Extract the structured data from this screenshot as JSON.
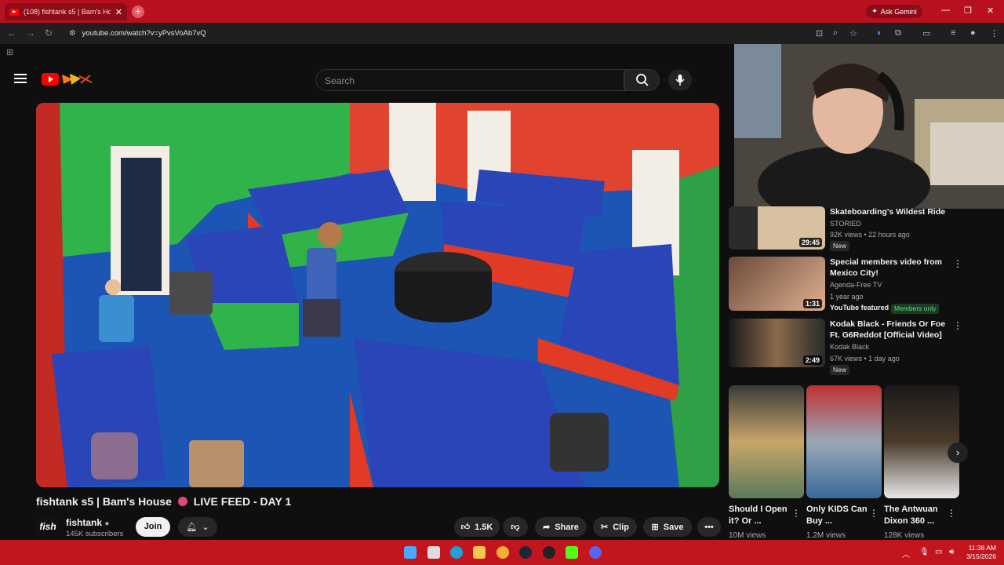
{
  "browser": {
    "tab_title": "(108) fishtank s5 | Bam's Ho",
    "url": "youtube.com/watch?v=yPvsVoAb7vQ",
    "gemini_label": "Ask Gemini"
  },
  "youtube": {
    "search_placeholder": "Search"
  },
  "video": {
    "title_part1": "fishtank s5 | Bam's House",
    "title_part2": "LIVE FEED - DAY 1",
    "channel_name": "fishtank",
    "channel_avatar_text": "fish",
    "subscribers": "145K subscribers",
    "join_label": "Join",
    "likes": "1.5K",
    "share_label": "Share",
    "clip_label": "Clip",
    "save_label": "Save"
  },
  "recommendations": [
    {
      "title": "Skateboarding's Wildest Ride",
      "channel": "STORIED",
      "meta": "92K views • 22 hours ago",
      "duration": "29:45",
      "badge": "New"
    },
    {
      "title": "Special members video from Mexico City!",
      "channel": "Agenda-Free TV",
      "meta": "1 year ago",
      "duration": "1:31",
      "featured": "YouTube featured",
      "members": "Members only"
    },
    {
      "title": "Kodak Black - Friends Or Foe Ft. G6Reddot [Official Video]",
      "channel": "Kodak Black",
      "meta": "67K views • 1 day ago",
      "duration": "2:49",
      "badge": "New"
    }
  ],
  "shorts": [
    {
      "title": "Should I Open it? Or ...",
      "views": "10M views"
    },
    {
      "title": "Only KIDS Can Buy ...",
      "views": "1.2M views"
    },
    {
      "title": "The Antwuan Dixon 360 ...",
      "views": "128K views"
    }
  ],
  "taskbar": {
    "time": "11:38 AM",
    "date": "3/15/2026"
  },
  "colors": {
    "browser_red": "#b8101f",
    "youtube_red": "#ff0000",
    "room_blue": "#1d55b5",
    "wall_green": "#2fb34a",
    "wall_red": "#e0442e"
  }
}
